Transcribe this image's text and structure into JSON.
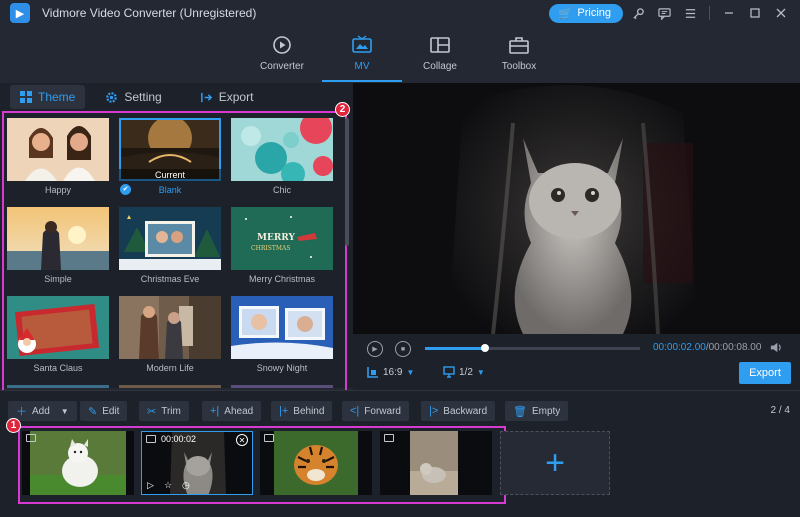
{
  "window": {
    "title": "Vidmore Video Converter (Unregistered)",
    "pricing_label": "Pricing"
  },
  "nav": {
    "tabs": [
      {
        "label": "Converter",
        "icon": "converter-icon"
      },
      {
        "label": "MV",
        "icon": "mv-icon",
        "active": true
      },
      {
        "label": "Collage",
        "icon": "collage-icon"
      },
      {
        "label": "Toolbox",
        "icon": "toolbox-icon"
      }
    ]
  },
  "subtabs": [
    {
      "label": "Theme",
      "icon": "grid-icon",
      "active": true
    },
    {
      "label": "Setting",
      "icon": "gear-icon"
    },
    {
      "label": "Export",
      "icon": "export-icon"
    }
  ],
  "themes": [
    {
      "label": "Happy"
    },
    {
      "label": "Blank",
      "selected": true,
      "overlay": "Current"
    },
    {
      "label": "Chic"
    },
    {
      "label": "Simple"
    },
    {
      "label": "Christmas Eve"
    },
    {
      "label": "Merry Christmas"
    },
    {
      "label": "Santa Claus"
    },
    {
      "label": "Modern Life"
    },
    {
      "label": "Snowy Night"
    }
  ],
  "badges": {
    "themes": "2",
    "clips": "1"
  },
  "player": {
    "current_time": "00:00:02.00",
    "total_time": "/00:00:08.00",
    "progress": 0.28,
    "aspect_ratio": "16:9",
    "zoom": "1/2",
    "export_label": "Export"
  },
  "toolbar": {
    "add": "Add",
    "edit": "Edit",
    "trim": "Trim",
    "ahead": "Ahead",
    "behind": "Behind",
    "forward": "Forward",
    "backward": "Backward",
    "empty": "Empty",
    "pager": "2 / 4"
  },
  "clips": [
    {
      "subject": "dog"
    },
    {
      "subject": "cat",
      "selected": true,
      "time": "00:00:02"
    },
    {
      "subject": "tiger"
    },
    {
      "subject": "cat-outdoor"
    }
  ],
  "colors": {
    "accent": "#2f9df0",
    "highlight": "#d63ad0",
    "badge": "#e0243b"
  }
}
